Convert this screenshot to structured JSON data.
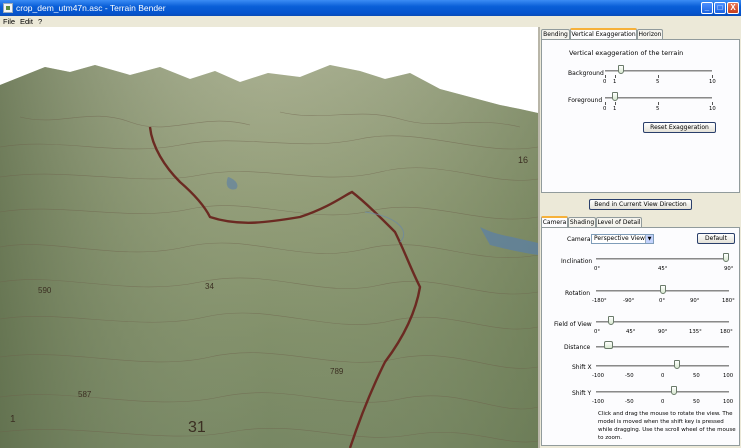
{
  "window": {
    "title": "crop_dem_utm47n.asc - Terrain Bender",
    "minimize": "_",
    "maximize": "□",
    "close": "X"
  },
  "menu": [
    "File",
    "Edit",
    "?"
  ],
  "top_tabs": [
    "Bending",
    "Vertical Exaggeration",
    "Horizon"
  ],
  "exaggeration": {
    "heading": "Vertical exaggeration of the terrain",
    "background_label": "Background",
    "foreground_label": "Foreground",
    "ticks": [
      "0",
      "1",
      "5",
      "10"
    ],
    "background_value": 1.5,
    "foreground_value": 0.9,
    "reset_button": "Reset Exaggeration"
  },
  "bend_button": "Bend in Current View Direction",
  "bottom_tabs": [
    "Camera",
    "Shading",
    "Level of Detail"
  ],
  "camera": {
    "label": "Camera",
    "view": "Perspective View",
    "default_button": "Default",
    "inclination_label": "Inclination",
    "inclination_ticks": [
      "0°",
      "45°",
      "90°"
    ],
    "inclination_value": 88,
    "rotation_label": "Rotation",
    "rotation_ticks": [
      "-180°",
      "-90°",
      "0°",
      "90°",
      "180°"
    ],
    "rotation_value": 0,
    "fov_label": "Field of View",
    "fov_ticks": [
      "0°",
      "45°",
      "90°",
      "135°",
      "180°"
    ],
    "fov_value": 20,
    "distance_label": "Distance",
    "distance_value": 0.08,
    "shiftx_label": "Shift X",
    "shiftx_ticks": [
      "-100",
      "-50",
      "0",
      "50",
      "100"
    ],
    "shiftx_value": 22,
    "shifty_label": "Shift Y",
    "shifty_ticks": [
      "-100",
      "-50",
      "0",
      "50",
      "100"
    ],
    "shifty_value": 18
  },
  "help_text": "Click and drag the mouse to rotate the view. The model is moved when the shift key is pressed while dragging. Use the scroll wheel of the mouse to zoom.",
  "map_labels": [
    "16",
    "590",
    "34",
    "789",
    "31",
    "587",
    "1"
  ]
}
